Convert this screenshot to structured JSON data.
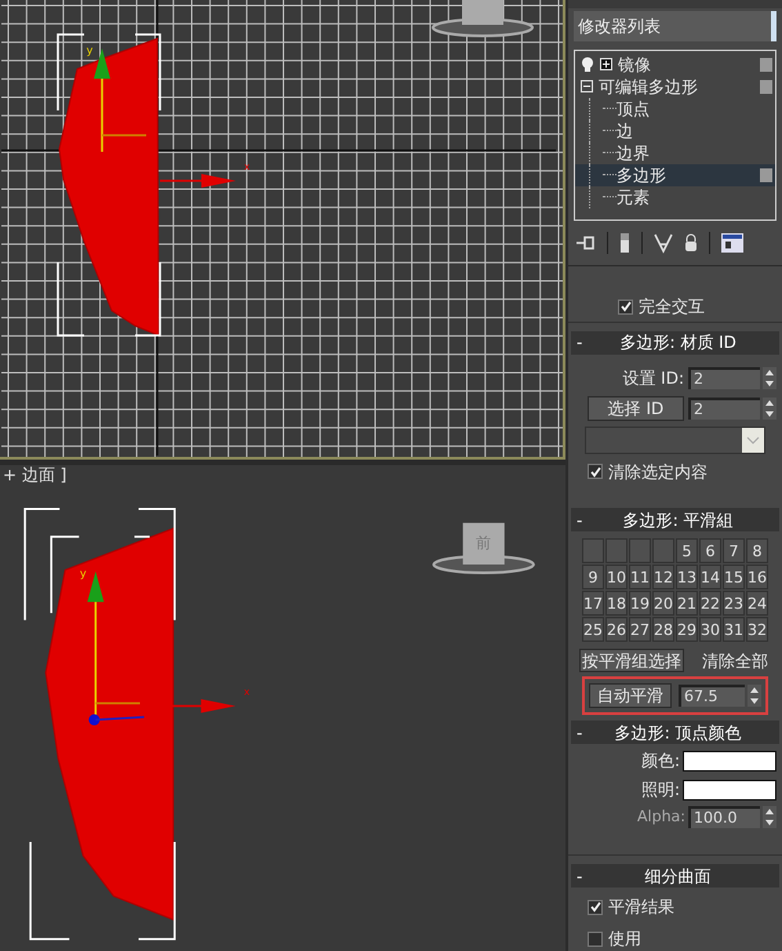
{
  "viewports": [
    {
      "kind": "grid",
      "axis_labels": {
        "y": "y",
        "x": "x"
      }
    },
    {
      "kind": "plain",
      "label": "+ 边面 ]",
      "view_cube_label": "前",
      "axis_labels": {
        "y": "y",
        "x": "x"
      }
    }
  ],
  "modifier_list": {
    "label": "修改器列表"
  },
  "modifier_stack": [
    {
      "label": "镜像",
      "expanded": false
    },
    {
      "label": "可编辑多边形",
      "expanded": true,
      "children": [
        {
          "label": "顶点",
          "selected": false
        },
        {
          "label": "边",
          "selected": false
        },
        {
          "label": "边界",
          "selected": false
        },
        {
          "label": "多边形",
          "selected": true
        },
        {
          "label": "元素",
          "selected": false
        }
      ]
    }
  ],
  "full_interaction": {
    "label": "完全交互",
    "checked": true
  },
  "rollouts": [
    {
      "kind": "material_id",
      "collapse_sign": "-",
      "title": "多边形: 材质 ID",
      "set_id": {
        "label": "设置 ID:",
        "value": "2"
      },
      "select_id": {
        "button": "选择 ID",
        "value": "2"
      },
      "clear_selection": {
        "label": "清除选定内容",
        "checked": true
      }
    },
    {
      "kind": "smoothing",
      "collapse_sign": "-",
      "title": "多边形: 平滑組",
      "groups": [
        {
          "kind": "blank"
        },
        {
          "kind": "blank"
        },
        {
          "kind": "blank"
        },
        {
          "kind": "blank"
        },
        {
          "kind": "numbered",
          "label": "5"
        },
        {
          "kind": "numbered",
          "label": "6"
        },
        {
          "kind": "numbered",
          "label": "7"
        },
        {
          "kind": "numbered",
          "label": "8"
        },
        {
          "kind": "numbered",
          "label": "9"
        },
        {
          "kind": "numbered",
          "label": "10"
        },
        {
          "kind": "numbered",
          "label": "11"
        },
        {
          "kind": "numbered",
          "label": "12"
        },
        {
          "kind": "numbered",
          "label": "13"
        },
        {
          "kind": "numbered",
          "label": "14"
        },
        {
          "kind": "numbered",
          "label": "15"
        },
        {
          "kind": "numbered",
          "label": "16"
        },
        {
          "kind": "numbered",
          "label": "17"
        },
        {
          "kind": "numbered",
          "label": "18"
        },
        {
          "kind": "numbered",
          "label": "19"
        },
        {
          "kind": "numbered",
          "label": "20"
        },
        {
          "kind": "numbered",
          "label": "21"
        },
        {
          "kind": "numbered",
          "label": "22"
        },
        {
          "kind": "numbered",
          "label": "23"
        },
        {
          "kind": "numbered",
          "label": "24"
        },
        {
          "kind": "numbered",
          "label": "25"
        },
        {
          "kind": "numbered",
          "label": "26"
        },
        {
          "kind": "numbered",
          "label": "27"
        },
        {
          "kind": "numbered",
          "label": "28"
        },
        {
          "kind": "numbered",
          "label": "29"
        },
        {
          "kind": "numbered",
          "label": "30"
        },
        {
          "kind": "numbered",
          "label": "31"
        },
        {
          "kind": "numbered",
          "label": "32"
        }
      ],
      "select_by": "按平滑组选择",
      "clear_all": "清除全部",
      "auto_smooth": {
        "button": "自动平滑",
        "value": "67.5",
        "highlighted": true
      }
    },
    {
      "kind": "vertex_color",
      "collapse_sign": "-",
      "title": "多边形: 顶点颜色",
      "fields": [
        {
          "kind": "swatch",
          "label": "颜色:",
          "color": "#ffffff"
        },
        {
          "kind": "swatch",
          "label": "照明:",
          "color": "#ffffff"
        },
        {
          "kind": "spinner",
          "label": "Alpha:",
          "value": "100.0"
        }
      ]
    },
    {
      "kind": "subdivision",
      "collapse_sign": "-",
      "title": "细分曲面",
      "options": [
        {
          "label": "平滑结果",
          "checked": true
        },
        {
          "label": "使用",
          "checked": false
        }
      ]
    }
  ]
}
